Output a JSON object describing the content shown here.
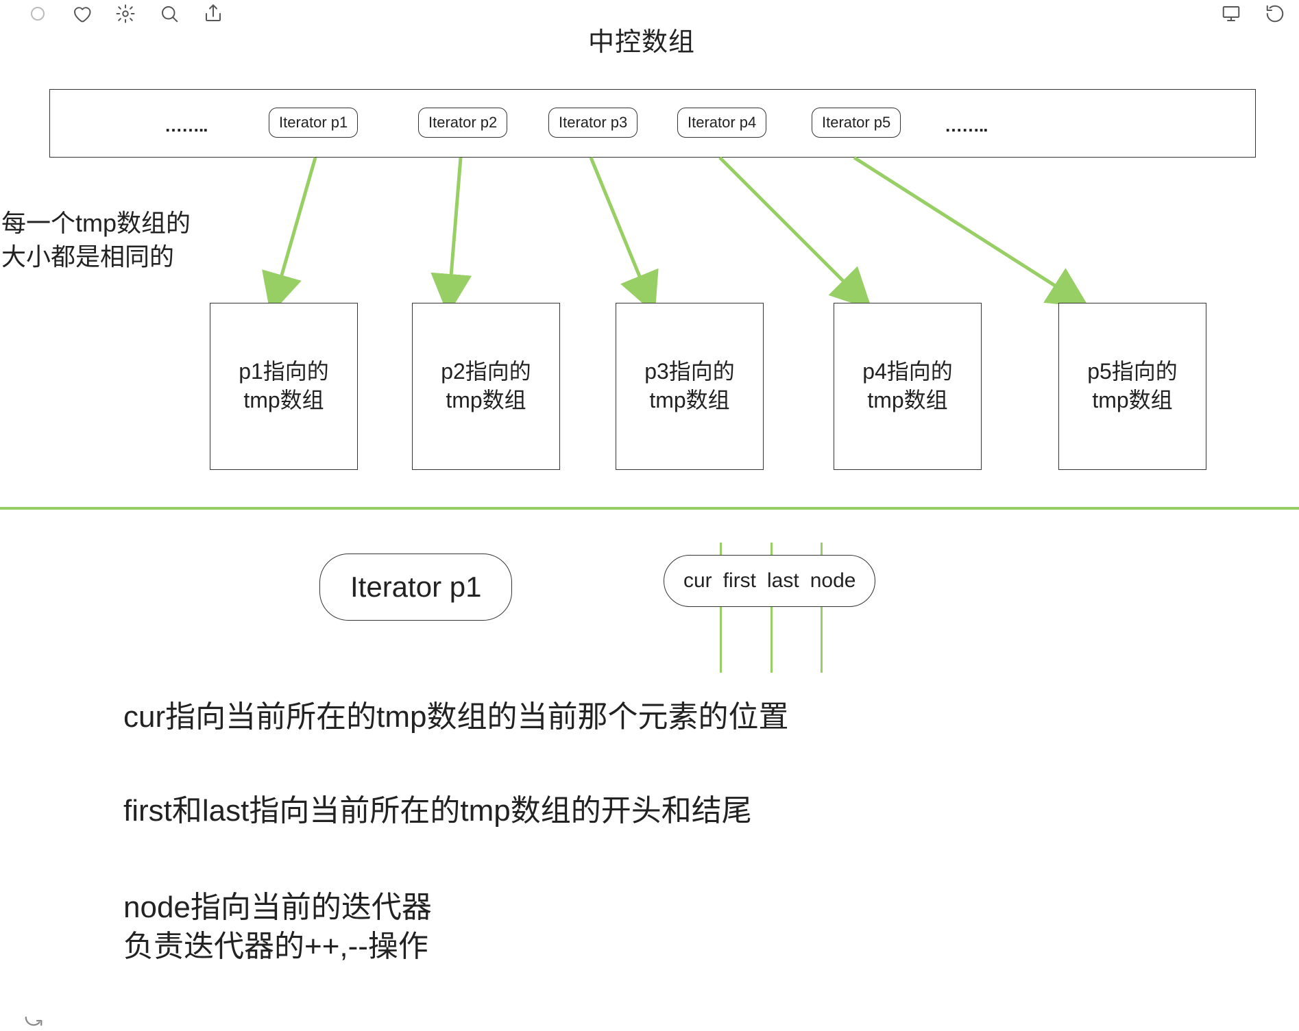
{
  "title": "中控数组",
  "dots_left": "……..",
  "dots_right": "……..",
  "iterators": [
    {
      "label": "Iterator p1",
      "tmp_line1": "p1指向的",
      "tmp_line2": "tmp数组"
    },
    {
      "label": "Iterator p2",
      "tmp_line1": "p2指向的",
      "tmp_line2": "tmp数组"
    },
    {
      "label": "Iterator p3",
      "tmp_line1": "p3指向的",
      "tmp_line2": "tmp数组"
    },
    {
      "label": "Iterator p4",
      "tmp_line1": "p4指向的",
      "tmp_line2": "tmp数组"
    },
    {
      "label": "Iterator p5",
      "tmp_line1": "p5指向的",
      "tmp_line2": "tmp数组"
    }
  ],
  "sidenote_line1": "每一个tmp数组的",
  "sidenote_line2": "大小都是相同的",
  "detail_iterator": "Iterator p1",
  "fields": {
    "cur": "cur",
    "first": "first",
    "last": "last",
    "node": "node"
  },
  "desc_cur": "cur指向当前所在的tmp数组的当前那个元素的位置",
  "desc_firstlast": "first和last指向当前所在的tmp数组的开头和结尾",
  "desc_node_l1": "node指向当前的迭代器",
  "desc_node_l2": "负责迭代器的++,--操作"
}
